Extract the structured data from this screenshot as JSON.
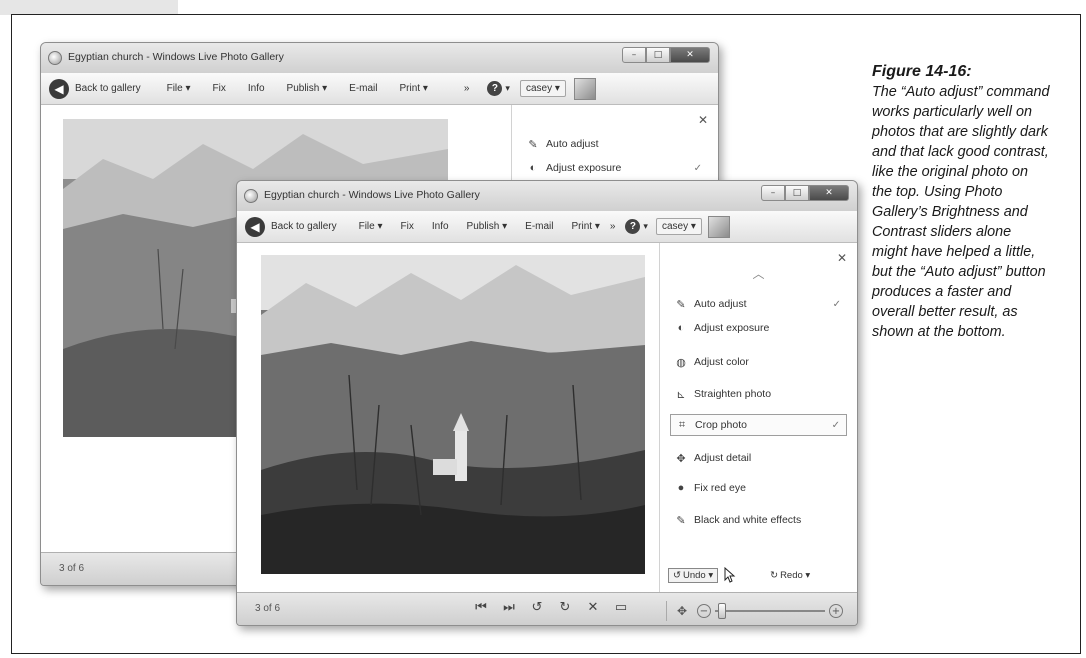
{
  "back_window": {
    "title": "Egyptian church - Windows Live Photo Gallery",
    "toolbar": {
      "back_label": "Back to gallery",
      "items": [
        "File ▾",
        "Fix",
        "Info",
        "Publish ▾",
        "E-mail",
        "Print ▾",
        "»"
      ],
      "user_label": "casey ▾"
    },
    "fix_panel": {
      "items": [
        {
          "label": "Auto adjust",
          "icon": "wand-icon"
        },
        {
          "label": "Adjust exposure",
          "icon": "exposure-icon",
          "check": "✓"
        }
      ]
    },
    "counter": "3 of 6"
  },
  "front_window": {
    "title": "Egyptian church - Windows Live Photo Gallery",
    "toolbar": {
      "back_label": "Back to gallery",
      "items": [
        "File ▾",
        "Fix",
        "Info",
        "Publish ▾",
        "E-mail",
        "Print ▾",
        "»"
      ],
      "user_label": "casey ▾"
    },
    "fix_panel": {
      "items": [
        {
          "label": "Auto adjust",
          "icon": "wand-icon",
          "check": "✓"
        },
        {
          "label": "Adjust exposure",
          "icon": "exposure-icon"
        },
        {
          "label": "Adjust color",
          "icon": "color-icon"
        },
        {
          "label": "Straighten photo",
          "icon": "straighten-icon"
        },
        {
          "label": "Crop photo",
          "icon": "crop-icon",
          "check": "✓"
        },
        {
          "label": "Adjust detail",
          "icon": "detail-icon"
        },
        {
          "label": "Fix red eye",
          "icon": "red-eye-icon"
        },
        {
          "label": "Black and white effects",
          "icon": "bw-effects-icon"
        }
      ],
      "undo_label": "Undo ▾",
      "redo_label": "Redo ▾"
    },
    "counter": "3 of 6",
    "zoom_level": 0.06
  },
  "caption": {
    "title": "Figure 14-16:",
    "body": "The “Auto adjust” command works particularly well on photos that are slightly dark and that lack good contrast, like the original photo on the top. Using Photo Gallery’s Brightness and Contrast sliders alone might have helped a little, but the “Auto adjust” button produces a faster and overall better result, as shown at the bottom."
  }
}
